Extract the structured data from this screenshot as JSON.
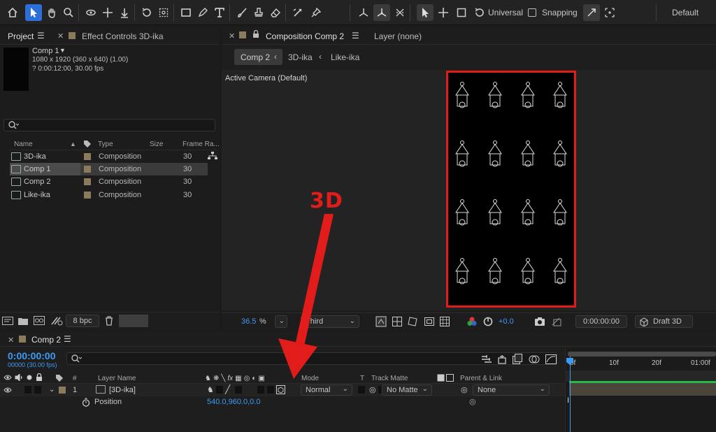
{
  "toolbar": {
    "universal_label": "Universal",
    "snapping_label": "Snapping",
    "workspace": "Default"
  },
  "project_panel": {
    "tab_project": "Project",
    "tab_effect_controls": "Effect Controls 3D-ika",
    "preview": {
      "name": "Comp 1",
      "dims": "1080 x 1920  (360 x 640) (1.00)",
      "duration": "? 0:00:12:00, 30.00 fps"
    },
    "search_placeholder": "",
    "columns": {
      "name": "Name",
      "type": "Type",
      "size": "Size",
      "frame_rate": "Frame Ra..."
    },
    "items": [
      {
        "name": "3D-ika",
        "type": "Composition",
        "frame_rate": "30"
      },
      {
        "name": "Comp 1",
        "type": "Composition",
        "frame_rate": "30"
      },
      {
        "name": "Comp 2",
        "type": "Composition",
        "frame_rate": "30"
      },
      {
        "name": "Like-ika",
        "type": "Composition",
        "frame_rate": "30"
      }
    ],
    "bpc": "8 bpc"
  },
  "composition_panel": {
    "tab_label": "Composition Comp 2",
    "layer_tab": "Layer (none)",
    "breadcrumbs": [
      "Comp 2",
      "3D-ika",
      "Like-ika"
    ],
    "camera_label": "Active Camera (Default)",
    "zoom": "36.5",
    "zoom_unit": "%",
    "view": "Third",
    "exposure": "+0.0",
    "timecode": "0:00:00:00",
    "renderer": "Draft 3D"
  },
  "annotation": {
    "label": "3D",
    "color": "#e21b1b"
  },
  "timeline": {
    "tab_label": "Comp 2",
    "timecode": "0:00:00:00",
    "frame_info": "00000 (30.00 fps)",
    "columns": {
      "num": "#",
      "layer_name": "Layer Name",
      "mode": "Mode",
      "t": "T",
      "track_matte": "Track Matte",
      "parent": "Parent & Link"
    },
    "layer": {
      "index": "1",
      "name": "[3D-ika]",
      "mode": "Normal",
      "matte": "No Matte",
      "parent": "None"
    },
    "property": {
      "name": "Position",
      "value": "540.0,960.0,0.0"
    },
    "ruler": [
      "0f",
      "10f",
      "20f",
      "01:00f"
    ]
  },
  "colors": {
    "accent": "#3e9bf5",
    "highlight": "#e21b1b",
    "label_swatch": "#8c7a5d"
  }
}
